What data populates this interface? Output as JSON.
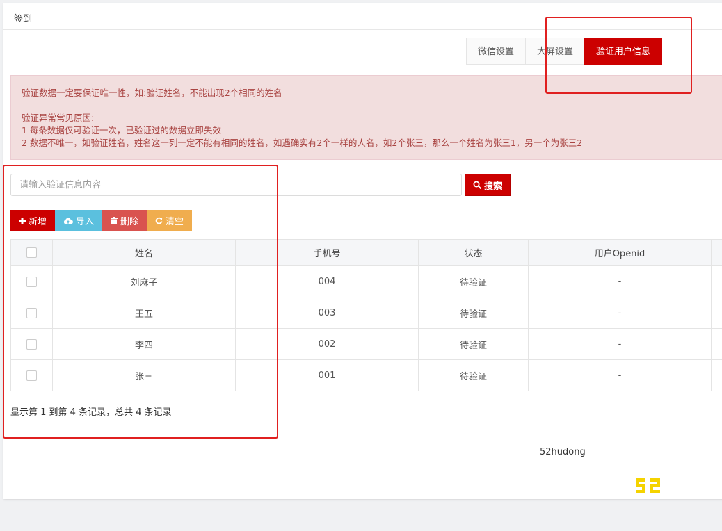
{
  "panel": {
    "title": "签到"
  },
  "tabs": [
    {
      "label": "微信设置",
      "active": false
    },
    {
      "label": "大屏设置",
      "active": false
    },
    {
      "label": "验证用户信息",
      "active": true
    }
  ],
  "alert": {
    "line1": "验证数据一定要保证唯一性，如:验证姓名，不能出现2个相同的姓名",
    "line2": "验证异常常见原因:",
    "line3": "1 每条数据仅可验证一次，已验证过的数据立即失效",
    "line4": "2 数据不唯一，如验证姓名，姓名这一列一定不能有相同的姓名，如遇确实有2个一样的人名，如2个张三，那么一个姓名为张三1，另一个为张三2"
  },
  "search": {
    "placeholder": "请输入验证信息内容",
    "value": "",
    "button_label": "搜索"
  },
  "toolbar": {
    "add_label": "新增",
    "import_label": "导入",
    "delete_label": "删除",
    "clear_label": "清空"
  },
  "table": {
    "headers": [
      "姓名",
      "手机号",
      "状态",
      "用户Openid"
    ],
    "rows": [
      {
        "name": "刘麻子",
        "phone": "004",
        "status": "待验证",
        "openid": "-"
      },
      {
        "name": "王五",
        "phone": "003",
        "status": "待验证",
        "openid": "-"
      },
      {
        "name": "李四",
        "phone": "002",
        "status": "待验证",
        "openid": "-"
      },
      {
        "name": "张三",
        "phone": "001",
        "status": "待验证",
        "openid": "-"
      }
    ]
  },
  "pager": {
    "summary": "显示第 1 到第 4 条记录，总共 4 条记录"
  },
  "footer": {
    "text": "52hudong",
    "logo_text": "52"
  },
  "colors": {
    "accent": "#cc0000",
    "alert_bg": "#f2dede",
    "alert_text": "#a94442",
    "import": "#5bc0de",
    "delete": "#d9534f",
    "clear": "#f0ad4e",
    "logo": "#f5d300",
    "annotation": "#e02020"
  }
}
